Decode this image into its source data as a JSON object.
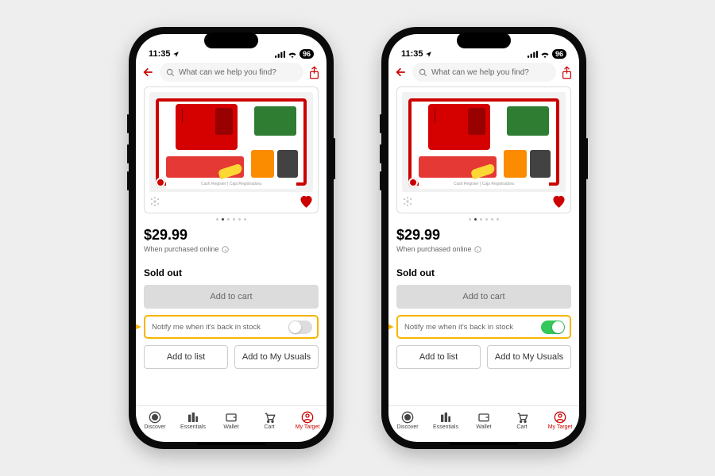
{
  "status": {
    "time": "11:35",
    "battery": "96"
  },
  "search": {
    "placeholder": "What can we help you find?"
  },
  "product": {
    "price": "$29.99",
    "context_line": "When purchased online",
    "image_caption": "Cash Register | Caja Registradora"
  },
  "stock": {
    "status": "Sold out",
    "add_to_cart": "Add to cart",
    "notify_label": "Notify me when it's back in stock",
    "add_to_list": "Add to list",
    "add_to_usuals": "Add to My Usuals"
  },
  "tabs": {
    "discover": "Discover",
    "essentials": "Essentials",
    "wallet": "Wallet",
    "cart": "Cart",
    "mytarget": "My Target"
  },
  "screens": {
    "left": {
      "notify_on": false
    },
    "right": {
      "notify_on": true
    }
  }
}
